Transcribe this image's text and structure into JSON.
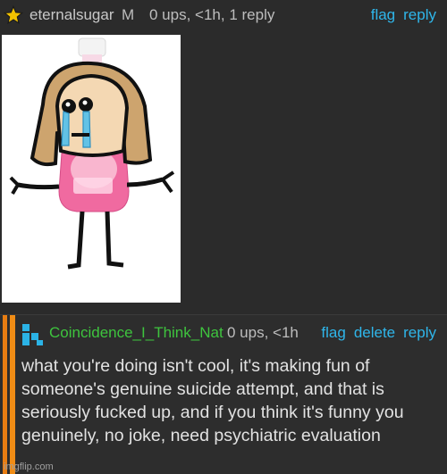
{
  "comment1": {
    "username": "eternalsugar",
    "badge": "M",
    "meta": "0 ups, <1h, 1 reply",
    "actions": {
      "flag": "flag",
      "reply": "reply"
    },
    "icon": "star-icon",
    "image_alt": "stick figure drawn over a pink mouthwash bottle"
  },
  "comment2": {
    "username": "Coincidence_I_Think_Nat",
    "meta": "0 ups, <1h",
    "actions": {
      "flag": "flag",
      "delete": "delete",
      "reply": "reply"
    },
    "icon": "user-logo-icon",
    "text": "what you're doing isn't cool, it's making fun of someone's genuine suicide attempt, and that is seriously fucked up, and if you think it's funny you genuinely, no joke, need psychiatric evaluation"
  },
  "watermark": "imgflip.com",
  "colors": {
    "link": "#2fb6ea",
    "username_green": "#3ec43e",
    "thread_bar": "#f08c15",
    "star": "#f2c200"
  }
}
